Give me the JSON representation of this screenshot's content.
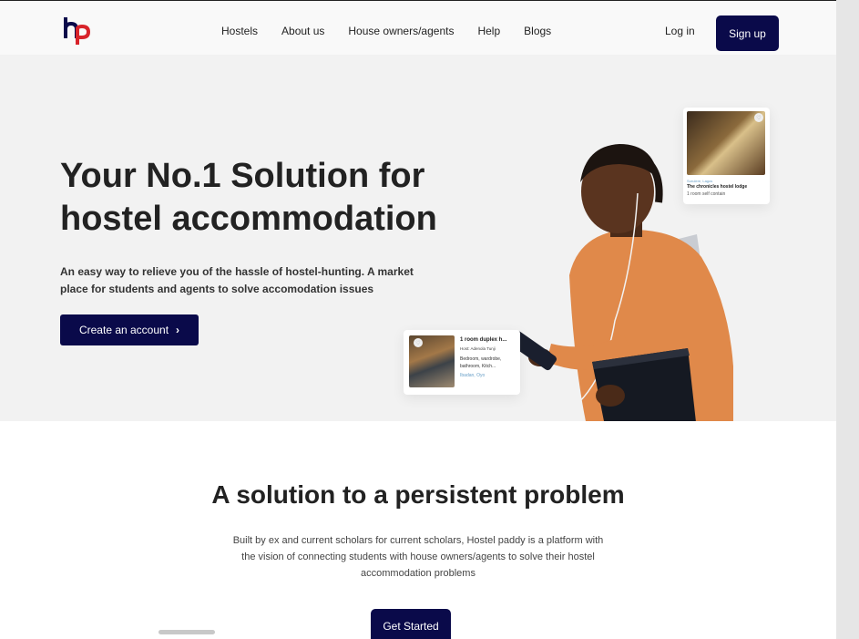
{
  "nav": {
    "links": [
      "Hostels",
      "About us",
      "House owners/agents",
      "Help",
      "Blogs"
    ],
    "login": "Log in",
    "signup": "Sign up"
  },
  "hero": {
    "title": "Your No.1 Solution for hostel accommodation",
    "subtitle": "An easy way to relieve you of the hassle of hostel-hunting. A market place for students and agents to solve accomodation issues",
    "cta": "Create an account"
  },
  "card_top": {
    "location": "Surulere, Lagos",
    "name": "The chronicles hostel lodge",
    "desc": "1 room self contain"
  },
  "card_bottom": {
    "title": "1 room duplex h...",
    "host": "Host: Adenola Tunji",
    "desc": "Bedroom, wardrobe, bathroom, Kitch...",
    "location": "Ibadan, Oyo"
  },
  "section2": {
    "title": "A solution to a persistent problem",
    "text": "Built by ex and current scholars for current scholars, Hostel paddy is a platform with the vision of connecting students with house owners/agents to solve their hostel accommodation problems",
    "button": "Get Started"
  },
  "colors": {
    "brand_navy": "#0a0a4a",
    "logo_red": "#d8232a",
    "hero_bg": "#f2f2f2",
    "sweater": "#e0894a"
  }
}
